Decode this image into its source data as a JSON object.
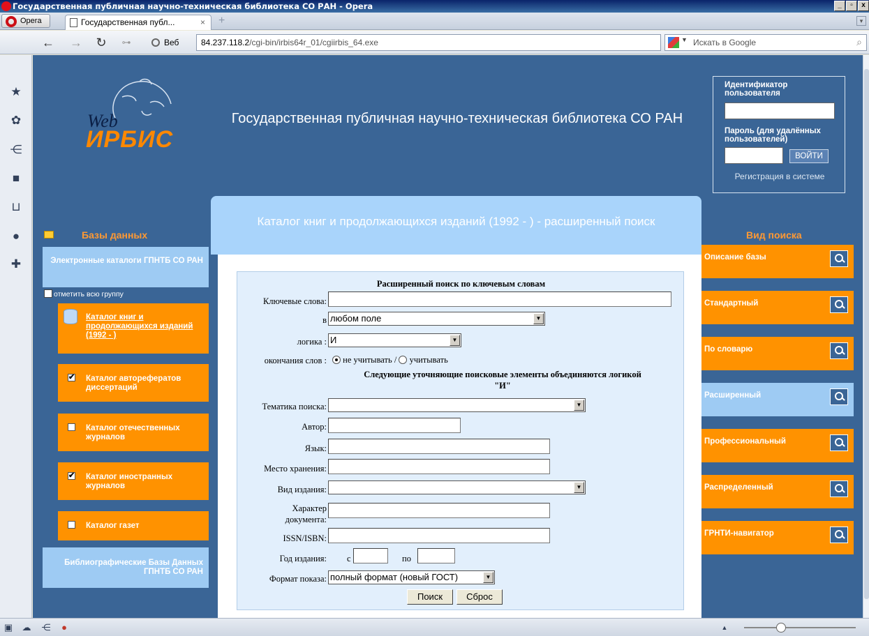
{
  "window": {
    "title": "Государственная публичная научно-техническая библиотека СО РАН - Opera",
    "controls": [
      "_",
      "▫",
      "x"
    ]
  },
  "tabs": {
    "opera_menu": "Opera",
    "active_tab": "Государственная публ...",
    "close": "×",
    "new_tab": "+"
  },
  "address": {
    "web_label": "Веб",
    "url_host": "84.237.118.2",
    "url_path": "/cgi-bin/irbis64r_01/cgiirbis_64.exe",
    "search_placeholder": "Искать в Google"
  },
  "header": {
    "logo_web": "Web",
    "logo_irbis": "ИРБИС",
    "library_title": "Государственная публичная научно-техническая библиотека СО РАН"
  },
  "login": {
    "user_id_label": "Идентификатор пользователя",
    "password_label": "Пароль (для удалённых пользователей)",
    "login_button": "ВОЙТИ",
    "register_link": "Регистрация в системе"
  },
  "left": {
    "databases_title": "Базы данных",
    "electronic_catalogs": "Электронные каталоги ГПНТБ СО РАН",
    "mark_all": "отметить всю группу",
    "catalogs": [
      {
        "label": "Каталог книг и продолжающихся изданий (1992 - )",
        "checked": false,
        "active": true
      },
      {
        "label": "Каталог авторефератов диссертаций",
        "checked": true
      },
      {
        "label": "Каталог отечественных журналов",
        "checked": false
      },
      {
        "label": "Каталог иностранных журналов",
        "checked": true
      },
      {
        "label": "Каталог газет",
        "checked": false
      }
    ],
    "bibliographic": "Библиографические Базы Данных ГПНТБ СО РАН"
  },
  "center": {
    "title": "Каталог книг и продолжающихся изданий (1992 - ) - расширенный поиск",
    "form": {
      "heading": "Расширенный поиск по ключевым словам",
      "keywords_label": "Ключевые слова:",
      "in_label": "в",
      "in_value": "любом поле",
      "logic_label": "логика :",
      "logic_value": "И",
      "endings_label": "окончания слов :",
      "endings_ignore": "не учитывать /",
      "endings_consider": "учитывать",
      "refine_note": "Следующие уточняющие поисковые элементы объединяются логикой",
      "refine_logic": "\"И\"",
      "topic_label": "Тематика поиска:",
      "author_label": "Автор:",
      "language_label": "Язык:",
      "storage_label": "Место хранения:",
      "edition_type_label": "Вид издания:",
      "doc_character_label_1": "Характер",
      "doc_character_label_2": "документа:",
      "issn_label": "ISSN/ISBN:",
      "year_label": "Год издания:",
      "year_from": "с",
      "year_to": "по",
      "format_label": "Формат показа:",
      "format_value": "полный формат (новый ГОСТ)",
      "search_button": "Поиск",
      "reset_button": "Сброс"
    }
  },
  "right": {
    "search_type_title": "Вид поиска",
    "items": [
      {
        "label": "Описание базы",
        "active": false
      },
      {
        "label": "Стандартный",
        "active": false
      },
      {
        "label": "По словарю",
        "active": false
      },
      {
        "label": "Расширенный",
        "active": true
      },
      {
        "label": "Профессиональный",
        "active": false
      },
      {
        "label": "Распределенный",
        "active": false
      },
      {
        "label": "ГРНТИ-навигатор",
        "active": false
      }
    ]
  },
  "colors": {
    "page_bg": "#3a6596",
    "orange": "#ff9200",
    "light_blue": "#9ecbf3",
    "form_bg": "#e2effc"
  }
}
